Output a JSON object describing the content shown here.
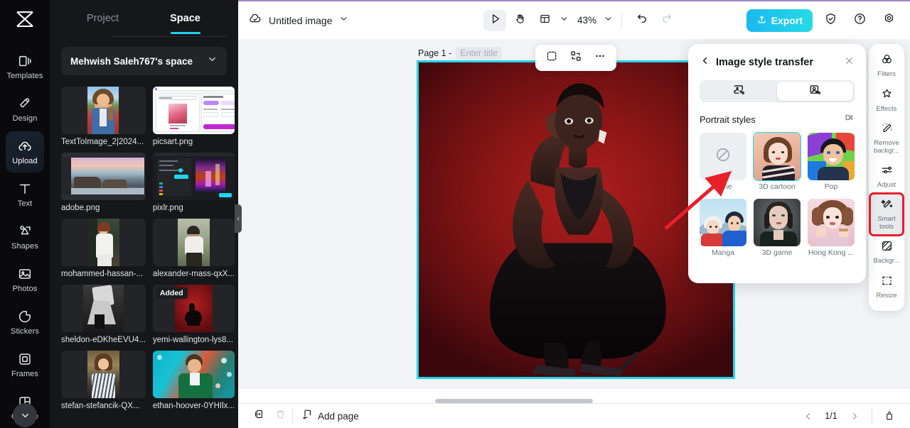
{
  "app": {
    "logo": "capcut-logo"
  },
  "left_rail": {
    "items": [
      {
        "label": "Templates",
        "icon": "templates-icon",
        "active": false
      },
      {
        "label": "Design",
        "icon": "design-icon",
        "active": false
      },
      {
        "label": "Upload",
        "icon": "upload-cloud-icon",
        "active": true
      },
      {
        "label": "Text",
        "icon": "text-icon",
        "active": false
      },
      {
        "label": "Shapes",
        "icon": "shapes-icon",
        "active": false
      },
      {
        "label": "Photos",
        "icon": "photos-icon",
        "active": false
      },
      {
        "label": "Stickers",
        "icon": "stickers-icon",
        "active": false
      },
      {
        "label": "Frames",
        "icon": "frames-icon",
        "active": false
      },
      {
        "label": "Collage",
        "icon": "collage-icon",
        "active": false
      }
    ],
    "collapse_icon": "chevron-down-icon"
  },
  "panel": {
    "tabs": [
      {
        "label": "Project",
        "active": false
      },
      {
        "label": "Space",
        "active": true
      }
    ],
    "space_selector": {
      "name": "Mehwish Saleh767's space",
      "chevron": "chevron-down-icon"
    },
    "assets": [
      {
        "name": "TextToImage_2|2024...",
        "thumb": "portrait-flowers",
        "added": false
      },
      {
        "name": "picsart.png",
        "thumb": "picsart-ui",
        "added": false
      },
      {
        "name": "adobe.png",
        "thumb": "adobe-ui",
        "added": false
      },
      {
        "name": "pixlr.png",
        "thumb": "pixlr-ui",
        "added": false
      },
      {
        "name": "mohammed-hassan-...",
        "thumb": "woman-white-door",
        "added": false
      },
      {
        "name": "alexander-mass-qxX...",
        "thumb": "woman-grass",
        "added": false
      },
      {
        "name": "sheldon-eDKheEVU4...",
        "thumb": "bw-dress",
        "added": false
      },
      {
        "name": "yemi-wallington-lys8...",
        "thumb": "red-crouching",
        "added": true,
        "badge": "Added"
      },
      {
        "name": "stefan-stefancik-QX...",
        "thumb": "woman-stripes",
        "added": false
      },
      {
        "name": "ethan-hoover-0YHIlx...",
        "thumb": "man-green-lights",
        "added": false
      }
    ]
  },
  "topbar": {
    "cloud_icon": "cloud-saved-icon",
    "doc_title": "Untitled image",
    "doc_chevron": "chevron-down-icon",
    "tools": [
      {
        "name": "select-tool",
        "icon": "cursor-arrow-icon",
        "selected": true
      },
      {
        "name": "hand-tool",
        "icon": "hand-icon",
        "selected": false
      },
      {
        "name": "layout-tool",
        "icon": "layout-icon",
        "selected": false
      }
    ],
    "layout_chevron": "chevron-down-icon",
    "zoom": "43%",
    "zoom_chevron": "chevron-down-icon",
    "undo_icon": "undo-icon",
    "redo_icon": "redo-icon",
    "export_label": "Export",
    "export_icon": "export-upload-icon",
    "export_color": "#1fc8e8",
    "shield_icon": "shield-check-icon",
    "help_icon": "question-circle-icon",
    "settings_icon": "gear-icon"
  },
  "canvas": {
    "page_label": "Page 1 -",
    "title_placeholder": "Enter title",
    "float_tools": [
      {
        "name": "crop-tool",
        "icon": "crop-selection-icon"
      },
      {
        "name": "arrange-tool",
        "icon": "arrange-icon"
      },
      {
        "name": "more-options",
        "icon": "ellipsis-icon"
      }
    ],
    "selection_color": "#22d3ee",
    "artwork": "woman-crouching-red-background"
  },
  "style_panel": {
    "back_icon": "chevron-left-icon",
    "title": "Image style transfer",
    "close_icon": "close-x-icon",
    "segments": [
      {
        "name": "image-style-tab",
        "icon": "image-style-icon",
        "active": false
      },
      {
        "name": "portrait-style-tab",
        "icon": "portrait-style-icon",
        "active": true
      }
    ],
    "section_title": "Portrait styles",
    "section_action_icon": "compare-icon",
    "styles": [
      {
        "label": "None",
        "thumb": "none-slash",
        "selected": false
      },
      {
        "label": "3D cartoon",
        "thumb": "3d-cartoon-woman",
        "selected": true
      },
      {
        "label": "Pop",
        "thumb": "pop-art-man",
        "selected": false
      },
      {
        "label": "Manga",
        "thumb": "manga-couple-snow",
        "selected": false
      },
      {
        "label": "3D game",
        "thumb": "3d-game-woman",
        "selected": false
      },
      {
        "label": "Hong Kong ...",
        "thumb": "hongkong-illustration",
        "selected": false
      }
    ]
  },
  "right_rail": {
    "items": [
      {
        "label": "Filters",
        "icon": "filters-icon",
        "active": false,
        "highlighted": false
      },
      {
        "label": "Effects",
        "icon": "effects-icon",
        "active": false,
        "highlighted": false
      },
      {
        "label": "Remove backgr...",
        "icon": "remove-background-icon",
        "active": false,
        "highlighted": false
      },
      {
        "label": "Adjust",
        "icon": "adjust-sliders-icon",
        "active": false,
        "highlighted": false
      },
      {
        "label": "Smart tools",
        "icon": "magic-wand-icon",
        "active": true,
        "highlighted": true
      },
      {
        "label": "Backgr...",
        "icon": "background-icon",
        "active": false,
        "highlighted": false
      },
      {
        "label": "Resize",
        "icon": "resize-icon",
        "active": false,
        "highlighted": false
      }
    ],
    "highlight_color": "#e8202a"
  },
  "bottombar": {
    "duplicate_icon": "duplicate-page-icon",
    "delete_icon": "trash-icon",
    "add_page_label": "Add page",
    "add_page_icon": "add-page-icon",
    "prev_icon": "chevron-left-icon",
    "page_indicator": "1/1",
    "next_icon": "chevron-right-icon",
    "fit_icon": "fit-page-icon"
  },
  "annotation": {
    "arrow_color": "#e8202a",
    "points_to": "None"
  }
}
